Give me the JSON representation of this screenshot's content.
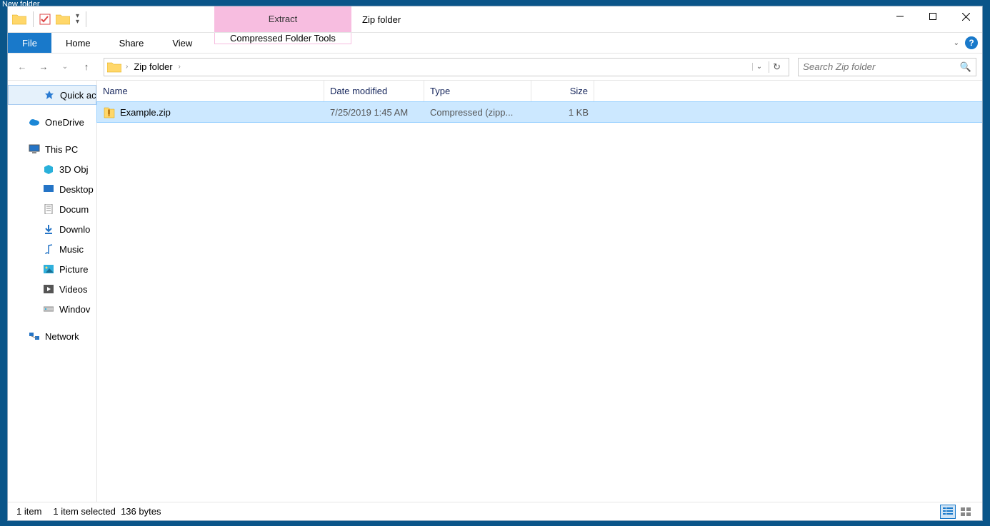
{
  "desktop": {
    "label": "New folder"
  },
  "titlebar": {
    "context_tab": "Extract",
    "title": "Zip folder"
  },
  "ribbon": {
    "file": "File",
    "home": "Home",
    "share": "Share",
    "view": "View",
    "contextual": "Compressed Folder Tools"
  },
  "address": {
    "crumb": "Zip folder"
  },
  "search": {
    "placeholder": "Search Zip folder"
  },
  "sidebar": {
    "quick_access": "Quick ac",
    "onedrive": "OneDrive",
    "this_pc": "This PC",
    "objects_3d": "3D Obj",
    "desktop": "Desktop",
    "documents": "Docum",
    "downloads": "Downlo",
    "music": "Music",
    "pictures": "Picture",
    "videos": "Videos",
    "windows": "Windov",
    "network": "Network"
  },
  "columns": {
    "name": "Name",
    "date": "Date modified",
    "type": "Type",
    "size": "Size"
  },
  "files": [
    {
      "name": "Example.zip",
      "date": "7/25/2019 1:45 AM",
      "type": "Compressed (zipp...",
      "size": "1 KB"
    }
  ],
  "status": {
    "count": "1 item",
    "selected": "1 item selected",
    "bytes": "136 bytes"
  }
}
